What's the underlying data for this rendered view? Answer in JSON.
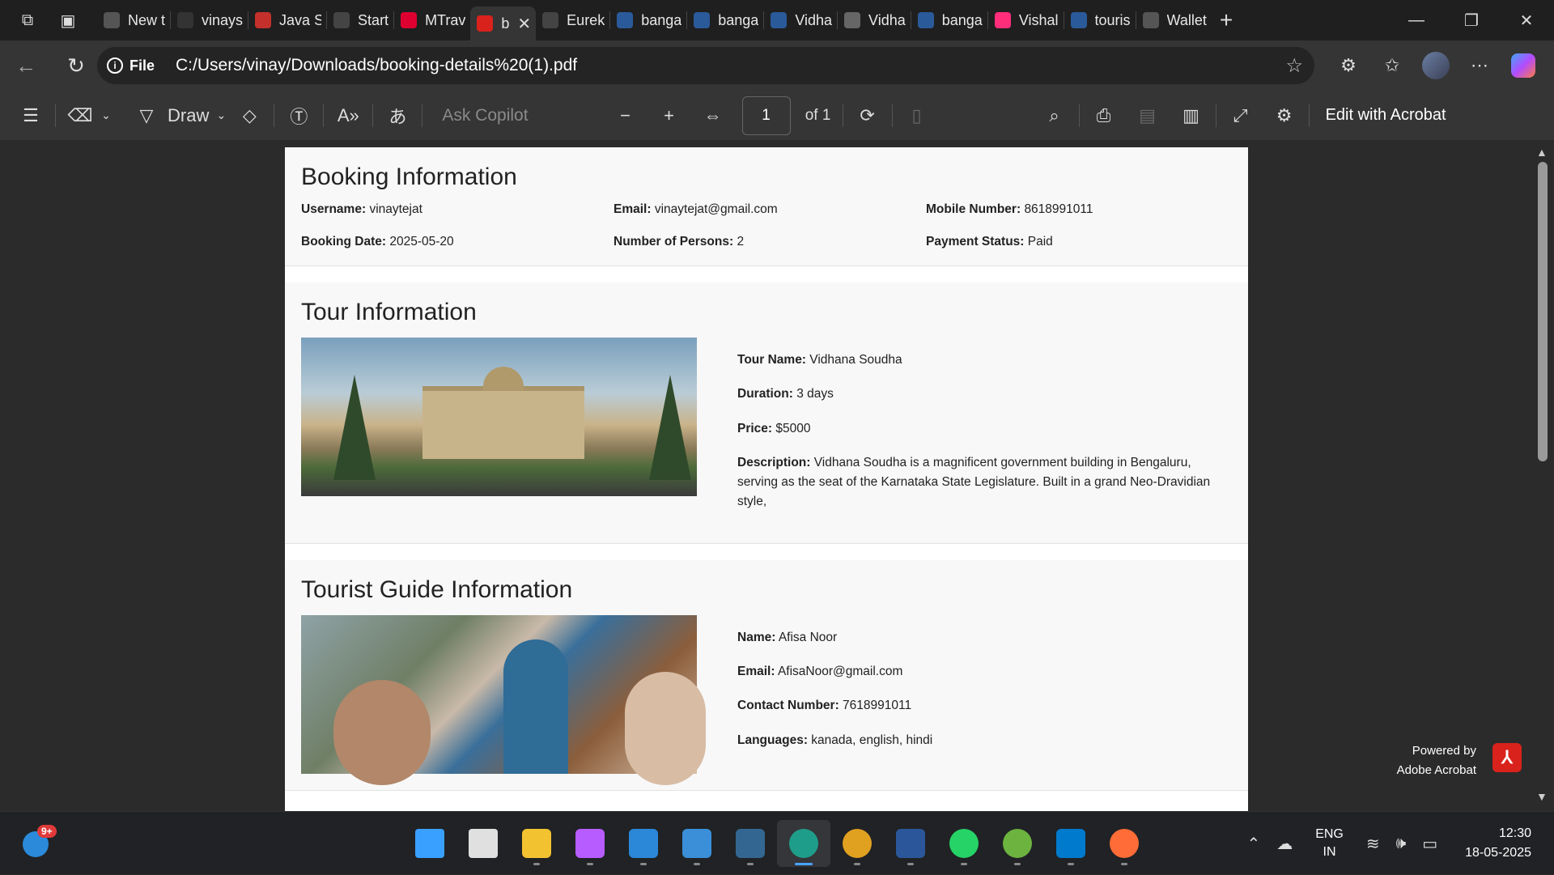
{
  "browser": {
    "tabs": [
      {
        "label": "New t",
        "icon": "new-tab-icon",
        "color": "#555555"
      },
      {
        "label": "vinays",
        "icon": "github-icon",
        "color": "#333333"
      },
      {
        "label": "Java S",
        "icon": "youtube-icon",
        "color": "#c4302b"
      },
      {
        "label": "Start",
        "icon": "openai-icon",
        "color": "#444444"
      },
      {
        "label": "MTrav",
        "icon": "angular-icon",
        "color": "#dd0031"
      },
      {
        "label": "b",
        "icon": "pdf-icon",
        "color": "#d9221c"
      },
      {
        "label": "Eurek",
        "icon": "globe-icon",
        "color": "#444444"
      },
      {
        "label": "banga",
        "icon": "search-icon",
        "color": "#2b5a9a"
      },
      {
        "label": "banga",
        "icon": "search-icon",
        "color": "#2b5a9a"
      },
      {
        "label": "Vidha",
        "icon": "search-icon",
        "color": "#2b5a9a"
      },
      {
        "label": "Vidha",
        "icon": "wikipedia-icon",
        "color": "#666666"
      },
      {
        "label": "banga",
        "icon": "search-icon",
        "color": "#2b5a9a"
      },
      {
        "label": "Vishal",
        "icon": "app-icon",
        "color": "#ff2d7a"
      },
      {
        "label": "touris",
        "icon": "search-icon",
        "color": "#2b5a9a"
      },
      {
        "label": "Wallet",
        "icon": "wallet-icon",
        "color": "#555555"
      }
    ],
    "file_label": "File",
    "url": "C:/Users/vinay/Downloads/booking-details%20(1).pdf"
  },
  "pdf_toolbar": {
    "draw_label": "Draw",
    "ask_copilot": "Ask Copilot",
    "page_value": "1",
    "page_total": "of 1",
    "edit_acrobat": "Edit with Acrobat"
  },
  "booking": {
    "title": "Booking Information",
    "username_label": "Username:",
    "username": "vinaytejat",
    "email_label": "Email:",
    "email": "vinaytejat@gmail.com",
    "mobile_label": "Mobile Number:",
    "mobile": "8618991011",
    "date_label": "Booking Date:",
    "date": "2025-05-20",
    "persons_label": "Number of Persons:",
    "persons": "2",
    "payment_label": "Payment Status:",
    "payment": "Paid"
  },
  "tour": {
    "title": "Tour Information",
    "name_label": "Tour Name:",
    "name": "Vidhana Soudha",
    "duration_label": "Duration:",
    "duration": "3 days",
    "price_label": "Price:",
    "price": "$5000",
    "desc_label": "Description:",
    "desc": "Vidhana Soudha is a magnificent government building in Bengaluru, serving as the seat of the Karnataka State Legislature. Built in a grand Neo-Dravidian style,"
  },
  "guide": {
    "title": "Tourist Guide Information",
    "name_label": "Name:",
    "name": "Afisa Noor",
    "email_label": "Email:",
    "email": "AfisaNoor@gmail.com",
    "contact_label": "Contact Number:",
    "contact": "7618991011",
    "lang_label": "Languages:",
    "languages": "kanada, english, hindi"
  },
  "acrobat": {
    "line1": "Powered by",
    "line2": "Adobe Acrobat"
  },
  "taskbar": {
    "badge": "9+",
    "apps": [
      "windows-start-icon",
      "search-icon",
      "file-explorer-icon",
      "copilot-icon",
      "microsoft-store-icon",
      "notepad-icon",
      "postgresql-icon",
      "edge-icon",
      "chrome-icon",
      "word-icon",
      "whatsapp-icon",
      "spring-icon",
      "vscode-icon",
      "postman-icon"
    ],
    "app_colors": [
      "#3aa0ff",
      "#e0e0e0",
      "#f2c230",
      "#b75cff",
      "#2b88d8",
      "#3a8fd8",
      "#336791",
      "#1e9e8a",
      "#e0a020",
      "#2b579a",
      "#25d366",
      "#6db33f",
      "#007acc",
      "#ff6c37"
    ],
    "lang1": "ENG",
    "lang2": "IN",
    "time": "12:30",
    "date": "18-05-2025"
  }
}
